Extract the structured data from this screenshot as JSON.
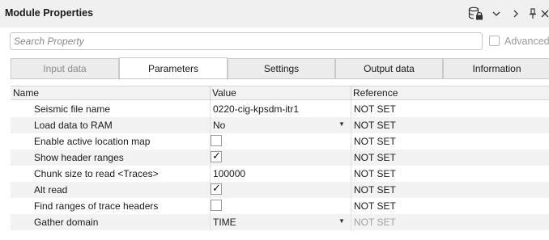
{
  "window": {
    "title": "Module Properties",
    "icons": [
      "database-lock-icon",
      "chevron-down-icon",
      "chevron-right-icon",
      "pin-icon",
      "close-icon"
    ]
  },
  "search": {
    "placeholder": "Search Property",
    "value": ""
  },
  "advanced": {
    "label": "Advanced",
    "checked": false
  },
  "tabs": [
    {
      "label": "Input data",
      "state": "disabled"
    },
    {
      "label": "Parameters",
      "state": "active"
    },
    {
      "label": "Settings",
      "state": "normal"
    },
    {
      "label": "Output data",
      "state": "normal"
    },
    {
      "label": "Information",
      "state": "normal"
    }
  ],
  "grid": {
    "columns": [
      "Name",
      "Value",
      "Reference"
    ],
    "rows": [
      {
        "name": "Seismic file name",
        "value": "0220-cig-kpsdm-itr1",
        "kind": "text",
        "reference": "NOT SET"
      },
      {
        "name": "Load data to RAM",
        "value": "No",
        "kind": "dropdown",
        "reference": "NOT SET"
      },
      {
        "name": "Enable active location map",
        "value": "",
        "kind": "checkbox",
        "checked": false,
        "reference": "NOT SET"
      },
      {
        "name": "Show header ranges",
        "value": "",
        "kind": "checkbox",
        "checked": true,
        "reference": "NOT SET"
      },
      {
        "name": "Chunk size to read <Traces>",
        "value": "100000",
        "kind": "text",
        "reference": "NOT SET"
      },
      {
        "name": "Alt read",
        "value": "",
        "kind": "checkbox",
        "checked": true,
        "reference": "NOT SET"
      },
      {
        "name": "Find ranges of trace headers",
        "value": "",
        "kind": "checkbox",
        "checked": false,
        "reference": "NOT SET"
      },
      {
        "name": "Gather domain",
        "value": "TIME",
        "kind": "dropdown",
        "reference": "NOT SET"
      }
    ]
  }
}
